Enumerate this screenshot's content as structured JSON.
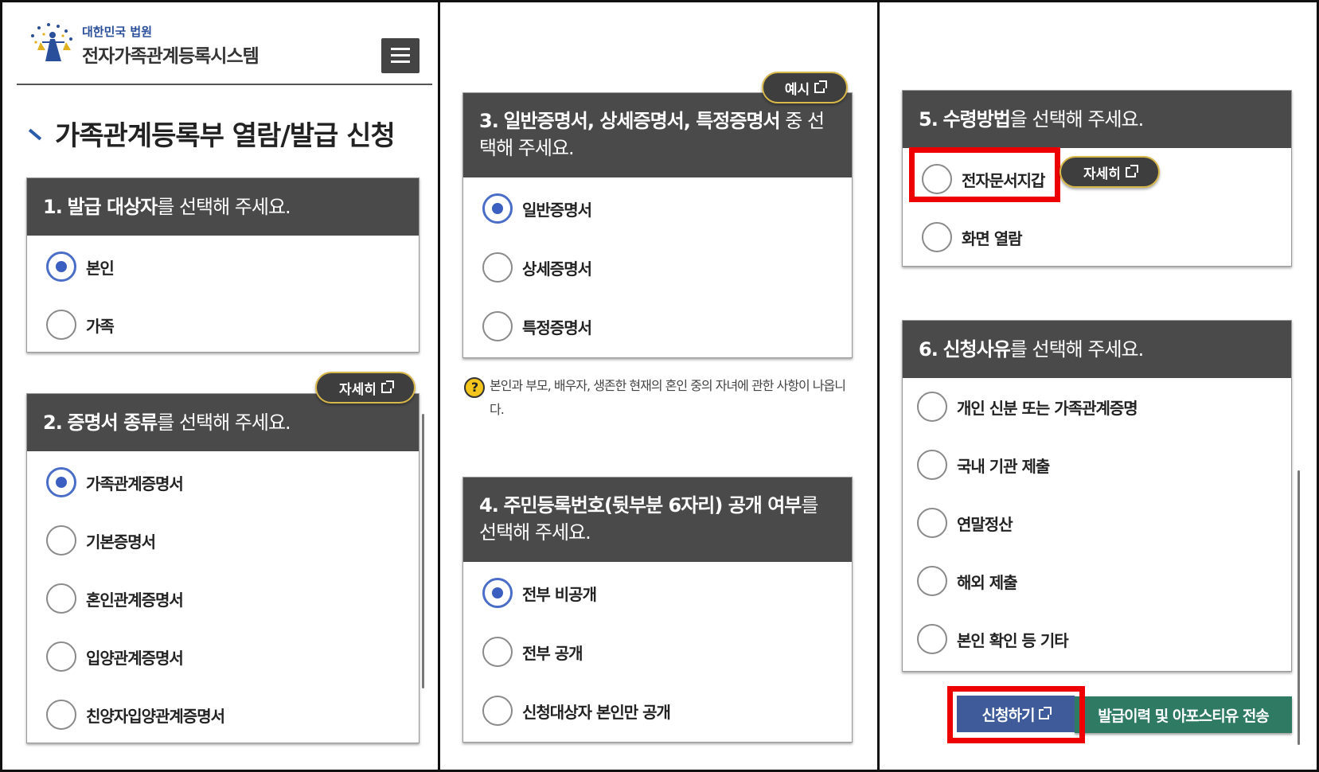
{
  "header": {
    "brand_small": "대한민국 법원",
    "brand_big": "전자가족관계등록시스템"
  },
  "page_title": "가족관계등록부 열람/발급 신청",
  "sections": {
    "s1": {
      "num": "1.",
      "strong": "발급 대상자",
      "rest": "를 선택해 주세요.",
      "options": [
        "본인",
        "가족"
      ],
      "selected": 0
    },
    "s2": {
      "num": "2.",
      "strong": "증명서 종류",
      "rest": "를 선택해 주세요.",
      "detail_label": "자세히",
      "options": [
        "가족관계증명서",
        "기본증명서",
        "혼인관계증명서",
        "입양관계증명서",
        "친양자입양관계증명서"
      ],
      "selected": 0
    },
    "s3": {
      "num": "3.",
      "strong": "일반증명서, 상세증명서, 특정증명서",
      "rest": " 중 선택해 주세요.",
      "example_label": "예시",
      "options": [
        "일반증명서",
        "상세증명서",
        "특정증명서"
      ],
      "selected": 0
    },
    "notice": "본인과 부모, 배우자, 생존한 현재의 혼인 중의 자녀에 관한 사항이 나옵니다.",
    "s4": {
      "num": "4.",
      "strong": "주민등록번호(뒷부분 6자리) 공개 여부",
      "rest": "를 선택해 주세요.",
      "options": [
        "전부 비공개",
        "전부 공개",
        "신청대상자 본인만 공개"
      ],
      "selected": 0
    },
    "s5": {
      "num": "5.",
      "strong": "수령방법",
      "rest": "을 선택해 주세요.",
      "detail_label": "자세히",
      "options": [
        "전자문서지갑",
        "화면 열람"
      ],
      "selected": -1
    },
    "s6": {
      "num": "6.",
      "strong": "신청사유",
      "rest": "를 선택해 주세요.",
      "options": [
        "개인 신분 또는 가족관계증명",
        "국내 기관 제출",
        "연말정산",
        "해외 제출",
        "본인 확인 등 기타"
      ],
      "selected": -1
    }
  },
  "buttons": {
    "apply": "신청하기",
    "history": "발급이력 및 아포스티유 전송"
  },
  "colors": {
    "header_bg": "#4a4a4a",
    "radio_selected": "#3a5fc0",
    "highlight": "#ee0000",
    "apply_btn": "#3f5b9a",
    "history_btn": "#2f7a63",
    "pill_border": "#d9b84a"
  }
}
